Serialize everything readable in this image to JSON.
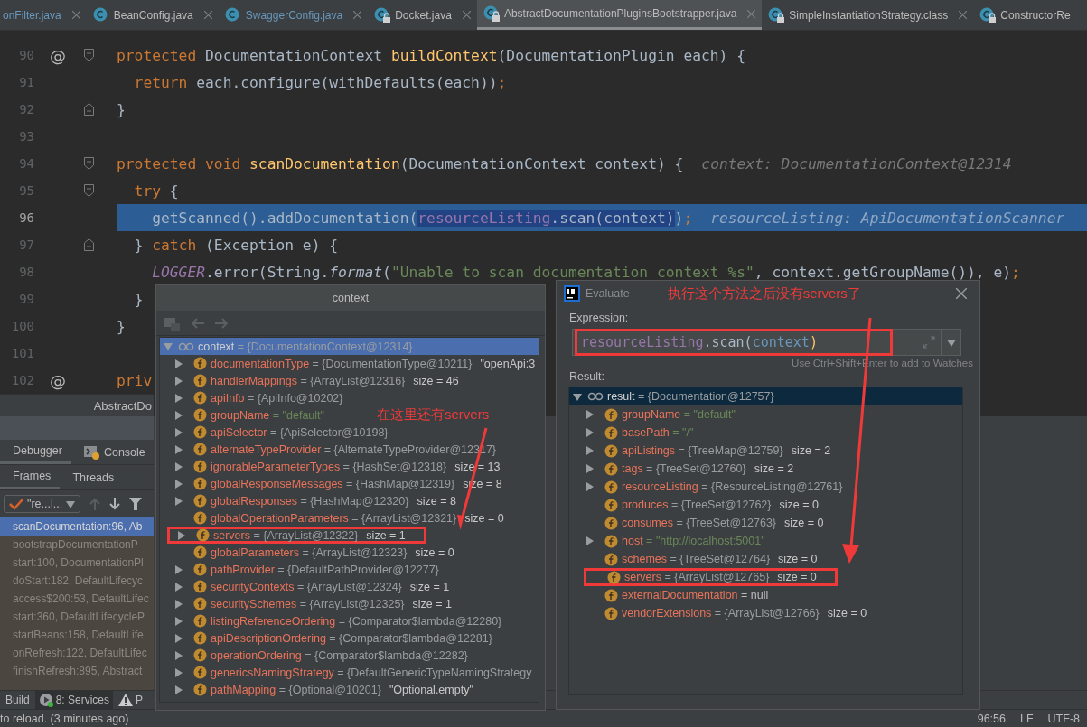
{
  "editor_tabs": [
    {
      "label": "onFilter.java",
      "selected": false,
      "modified": true,
      "icon": false,
      "closable": true
    },
    {
      "label": "BeanConfig.java",
      "selected": false,
      "modified": false,
      "icon": true,
      "locked": false,
      "closable": true
    },
    {
      "label": "SwaggerConfig.java",
      "selected": false,
      "modified": true,
      "icon": true,
      "locked": false,
      "closable": true
    },
    {
      "label": "Docket.java",
      "selected": false,
      "modified": false,
      "icon": true,
      "locked": true,
      "closable": true
    },
    {
      "label": "AbstractDocumentationPluginsBootstrapper.java",
      "selected": true,
      "modified": false,
      "icon": true,
      "locked": true,
      "closable": true
    },
    {
      "label": "SimpleInstantiationStrategy.class",
      "selected": false,
      "modified": false,
      "icon": true,
      "locked": true,
      "closable": true
    },
    {
      "label": "ConstructorRe",
      "selected": false,
      "modified": false,
      "icon": true,
      "locked": true,
      "closable": false
    }
  ],
  "code_lines": [
    {
      "number": "90",
      "marker": "@",
      "fold_start": true,
      "current": false,
      "tokens": [
        {
          "kind": "keyword",
          "text": "protected"
        },
        {
          "kind": "plain",
          "text": " DocumentationContext "
        },
        {
          "kind": "method",
          "text": "buildContext"
        },
        {
          "kind": "plain",
          "text": "(DocumentationPlugin each) {"
        }
      ]
    },
    {
      "number": "91",
      "current": false,
      "tokens": [
        {
          "kind": "keyword",
          "text": "  return"
        },
        {
          "kind": "plain",
          "text": " each.configure(withDefaults(each))"
        },
        {
          "kind": "punct",
          "text": ";"
        }
      ]
    },
    {
      "number": "92",
      "fold_start": false,
      "current": false,
      "tokens": [
        {
          "kind": "plain",
          "text": "}"
        }
      ]
    },
    {
      "number": "93",
      "current": false
    },
    {
      "number": "94",
      "fold_start": true,
      "current": false,
      "tokens": [
        {
          "kind": "keyword",
          "text": "protected void "
        },
        {
          "kind": "method",
          "text": "scanDocumentation"
        },
        {
          "kind": "plain",
          "text": "(DocumentationContext context) {"
        }
      ],
      "hint": "context: DocumentationContext@12314"
    },
    {
      "number": "95",
      "fold_start": true,
      "current": false,
      "tokens": [
        {
          "kind": "keyword",
          "text": "  try"
        },
        {
          "kind": "plain",
          "text": " {"
        }
      ]
    },
    {
      "number": "96",
      "current": true,
      "tokens": [
        {
          "kind": "plain",
          "text": "    getScanned().addDocumentation("
        },
        {
          "kind": "selected_field",
          "text": "resourceListing"
        },
        {
          "kind": "selected_plain",
          "text": ".scan(context)"
        },
        {
          "kind": "plain",
          "text": ")"
        },
        {
          "kind": "punct",
          "text": ";"
        }
      ],
      "hint": "resourceListing: ApiDocumentationScanner"
    },
    {
      "number": "97",
      "fold_start": false,
      "current": false,
      "tokens": [
        {
          "kind": "plain",
          "text": "  } "
        },
        {
          "kind": "keyword",
          "text": "catch"
        },
        {
          "kind": "plain",
          "text": " (Exception e) {"
        }
      ]
    },
    {
      "number": "98",
      "current": false,
      "tokens": [
        {
          "kind": "static",
          "text": "    LOGGER"
        },
        {
          "kind": "plain",
          "text": ".error(String."
        },
        {
          "kind": "italic",
          "text": "format"
        },
        {
          "kind": "plain",
          "text": "("
        },
        {
          "kind": "string",
          "text": "\"Unable to scan documentation context %s\""
        },
        {
          "kind": "plain",
          "text": ", context.getGroupName()), e)"
        },
        {
          "kind": "punct",
          "text": ";"
        }
      ]
    },
    {
      "number": "99",
      "current": false,
      "tokens": [
        {
          "kind": "plain",
          "text": "  }"
        }
      ]
    },
    {
      "number": "100",
      "current": false,
      "tokens": [
        {
          "kind": "plain",
          "text": "}"
        }
      ]
    },
    {
      "number": "101",
      "current": false
    },
    {
      "number": "102",
      "marker": "@",
      "current": false,
      "tokens": [
        {
          "kind": "keyword",
          "text": "priv"
        }
      ]
    }
  ],
  "debug_title": "AbstractDo",
  "debug_tabs": [
    {
      "label": "Debugger",
      "selected": true,
      "icon": false
    },
    {
      "label": "Console",
      "selected": false,
      "icon": true
    }
  ],
  "frame_tabs": [
    {
      "label": "Frames",
      "selected": true
    },
    {
      "label": "Threads",
      "selected": false
    }
  ],
  "thread_selector": "\"re...l...",
  "frame_tools": [
    {
      "kind": "up",
      "disabled": true
    },
    {
      "kind": "down",
      "disabled": false
    },
    {
      "kind": "filter",
      "disabled": false
    }
  ],
  "frames": [
    {
      "text": "scanDocumentation:96, Ab",
      "selected": true
    },
    {
      "text": "bootstrapDocumentationP",
      "selected": false
    },
    {
      "text": "start:100, DocumentationPl",
      "selected": false
    },
    {
      "text": "doStart:182, DefaultLifecyc",
      "selected": false
    },
    {
      "text": "access$200:53, DefaultLifec",
      "selected": false
    },
    {
      "text": "start:360, DefaultLifecycleP",
      "selected": false
    },
    {
      "text": "startBeans:158, DefaultLife",
      "selected": false
    },
    {
      "text": "onRefresh:122, DefaultLifec",
      "selected": false
    },
    {
      "text": "finishRefresh:895, Abstract",
      "selected": false
    }
  ],
  "tool_buttons": [
    {
      "label": "Build",
      "kind": "plain",
      "selected": false
    },
    {
      "label": "8: Services",
      "kind": "services",
      "selected": true
    },
    {
      "label": "P",
      "kind": "problems",
      "selected": false
    }
  ],
  "status_bar": {
    "message": "to reload. (3 minutes ago)",
    "position": "96:56",
    "line_separator": "LF",
    "encoding": "UTF-8"
  },
  "context_popup": {
    "title": "context",
    "note": "在这里还有servers",
    "tree": {
      "focused": true,
      "root": {
        "name": "context",
        "value": "= {DocumentationContext@12314}",
        "expanded": true,
        "selected": true
      },
      "items": [
        {
          "name": "documentationType",
          "value": "= {DocumentationType@10211}",
          "kind": "ref",
          "extra": "\"openApi:3",
          "expandable": true,
          "highlighted": false
        },
        {
          "name": "handlerMappings",
          "value": "= {ArrayList@12316}",
          "kind": "ref",
          "extra": "size = 46",
          "expandable": true,
          "highlighted": false
        },
        {
          "name": "apiInfo",
          "value": "= {ApiInfo@10202}",
          "kind": "ref",
          "expandable": true,
          "highlighted": false
        },
        {
          "name": "groupName",
          "value": "= \"default\"",
          "kind": "string",
          "expandable": true,
          "highlighted": false
        },
        {
          "name": "apiSelector",
          "value": "= {ApiSelector@10198}",
          "kind": "ref",
          "expandable": true,
          "highlighted": false
        },
        {
          "name": "alternateTypeProvider",
          "value": "= {AlternateTypeProvider@12317}",
          "kind": "ref",
          "expandable": true,
          "highlighted": false
        },
        {
          "name": "ignorableParameterTypes",
          "value": "= {HashSet@12318}",
          "kind": "ref",
          "extra": "size = 13",
          "expandable": true,
          "highlighted": false
        },
        {
          "name": "globalResponseMessages",
          "value": "= {HashMap@12319}",
          "kind": "ref",
          "extra": "size = 8",
          "expandable": true,
          "highlighted": false
        },
        {
          "name": "globalResponses",
          "value": "= {HashMap@12320}",
          "kind": "ref",
          "extra": "size = 8",
          "expandable": true,
          "highlighted": false
        },
        {
          "name": "globalOperationParameters",
          "value": "= {ArrayList@12321}",
          "kind": "ref",
          "extra": "size = 0",
          "expandable": false,
          "highlighted": false
        },
        {
          "name": "servers",
          "value": "= {ArrayList@12322}",
          "kind": "ref",
          "extra": "size = 1",
          "expandable": true,
          "highlighted": true
        },
        {
          "name": "globalParameters",
          "value": "= {ArrayList@12323}",
          "kind": "ref",
          "extra": "size = 0",
          "expandable": false,
          "highlighted": false
        },
        {
          "name": "pathProvider",
          "value": "= {DefaultPathProvider@12277}",
          "kind": "ref",
          "expandable": true,
          "highlighted": false
        },
        {
          "name": "securityContexts",
          "value": "= {ArrayList@12324}",
          "kind": "ref",
          "extra": "size = 1",
          "expandable": true,
          "highlighted": false
        },
        {
          "name": "securitySchemes",
          "value": "= {ArrayList@12325}",
          "kind": "ref",
          "extra": "size = 1",
          "expandable": true,
          "highlighted": false
        },
        {
          "name": "listingReferenceOrdering",
          "value": "= {Comparator$lambda@12280}",
          "kind": "ref",
          "expandable": true,
          "highlighted": false
        },
        {
          "name": "apiDescriptionOrdering",
          "value": "= {Comparator$lambda@12281}",
          "kind": "ref",
          "expandable": true,
          "highlighted": false
        },
        {
          "name": "operationOrdering",
          "value": "= {Comparator$lambda@12282}",
          "kind": "ref",
          "expandable": true,
          "highlighted": false
        },
        {
          "name": "genericsNamingStrategy",
          "value": "= {DefaultGenericTypeNamingStrategy",
          "kind": "ref",
          "expandable": true,
          "highlighted": false
        },
        {
          "name": "pathMapping",
          "value": "= {Optional@10201}",
          "kind": "ref",
          "extra": "\"Optional.empty\"",
          "expandable": true,
          "highlighted": false
        }
      ]
    }
  },
  "evaluate_popup": {
    "title": "Evaluate",
    "note": "执行这个方法之后没有servers了",
    "expression_label": "Expression:",
    "expression": [
      {
        "kind": "field",
        "text": "resourceListing"
      },
      {
        "kind": "plain",
        "text": ".scan("
      },
      {
        "kind": "param",
        "text": "context"
      },
      {
        "kind": "paren",
        "text": ")"
      }
    ],
    "expression_highlighted": true,
    "hint": "Use Ctrl+Shift+Enter to add to Watches",
    "result_label": "Result:",
    "tree": {
      "focused": false,
      "root": {
        "name": "result",
        "value": "= {Documentation@12757}",
        "expanded": true,
        "selected": true
      },
      "items": [
        {
          "name": "groupName",
          "value": "= \"default\"",
          "kind": "string",
          "expandable": true,
          "highlighted": false
        },
        {
          "name": "basePath",
          "value": "= \"/\"",
          "kind": "string",
          "expandable": true,
          "highlighted": false
        },
        {
          "name": "apiListings",
          "value": "= {TreeMap@12759}",
          "kind": "ref",
          "extra": "size = 2",
          "expandable": true,
          "highlighted": false
        },
        {
          "name": "tags",
          "value": "= {TreeSet@12760}",
          "kind": "ref",
          "extra": "size = 2",
          "expandable": true,
          "highlighted": false
        },
        {
          "name": "resourceListing",
          "value": "= {ResourceListing@12761}",
          "kind": "ref",
          "expandable": true,
          "highlighted": false
        },
        {
          "name": "produces",
          "value": "= {TreeSet@12762}",
          "kind": "ref",
          "extra": "size = 0",
          "expandable": false,
          "highlighted": false
        },
        {
          "name": "consumes",
          "value": "= {TreeSet@12763}",
          "kind": "ref",
          "extra": "size = 0",
          "expandable": false,
          "highlighted": false
        },
        {
          "name": "host",
          "value": "= \"http://localhost:5001\"",
          "kind": "string",
          "expandable": true,
          "highlighted": false
        },
        {
          "name": "schemes",
          "value": "= {TreeSet@12764}",
          "kind": "ref",
          "extra": "size = 0",
          "expandable": false,
          "highlighted": false
        },
        {
          "name": "servers",
          "value": "= {ArrayList@12765}",
          "kind": "ref",
          "extra": "size = 0",
          "expandable": false,
          "highlighted": true
        },
        {
          "name": "externalDocumentation",
          "value": "= null",
          "kind": "plain",
          "expandable": false,
          "highlighted": false
        },
        {
          "name": "vendorExtensions",
          "value": "= {ArrayList@12766}",
          "kind": "ref",
          "extra": "size = 0",
          "expandable": false,
          "highlighted": false
        }
      ]
    }
  }
}
